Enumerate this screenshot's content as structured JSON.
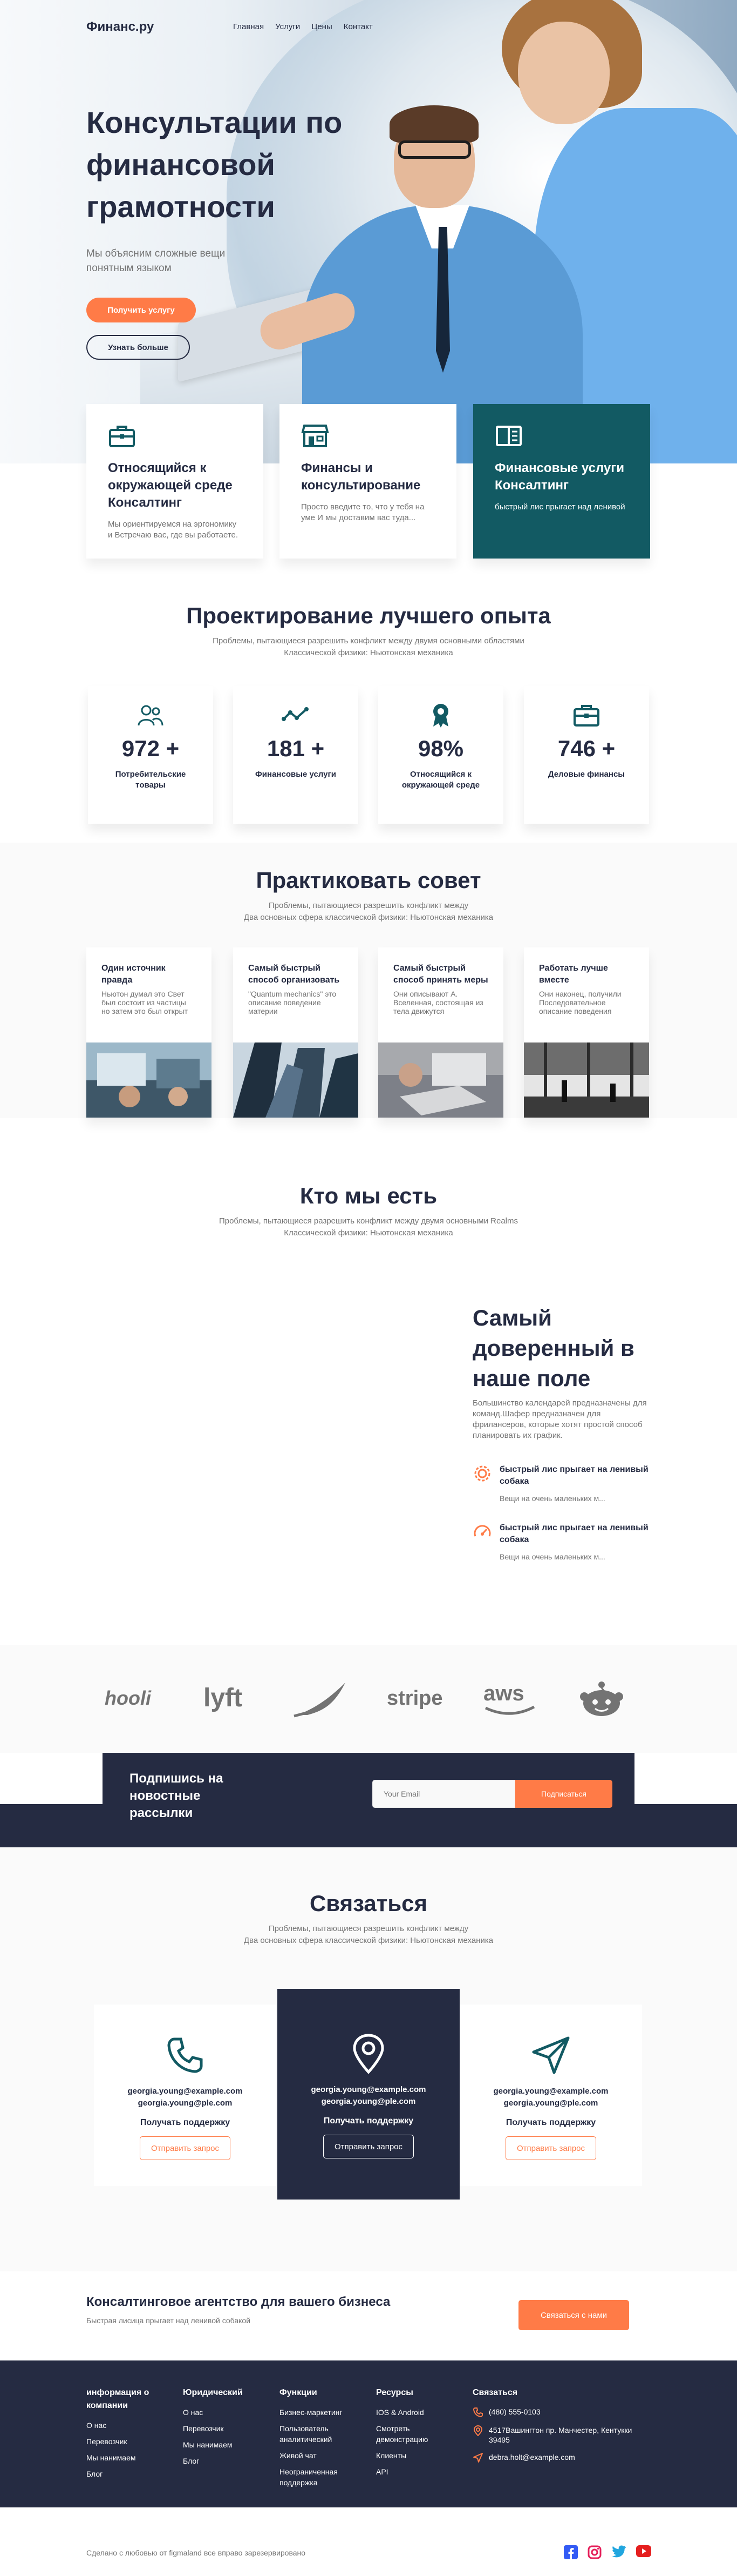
{
  "colors": {
    "primary": "#252b42",
    "accent": "#ff7b47",
    "teal": "#23856d",
    "dark_teal": "#125a63",
    "muted": "#737373"
  },
  "nav": {
    "logo": "Финанс.ру",
    "links": [
      "Главная",
      "Услуги",
      "Цены",
      "Контакт"
    ]
  },
  "hero": {
    "title": "Консультации по финансовой грамотности",
    "subtitle": "Мы объясним сложные вещи понятным языком",
    "primary_button": "Получить услугу",
    "secondary_button": "Узнать больше"
  },
  "features": [
    {
      "icon": "briefcase-icon",
      "title": "Относящийся к окружающей среде Консалтинг",
      "desc": "Мы ориентируемся на эргономику и Встречаю вас, где вы работаете."
    },
    {
      "icon": "storefront-icon",
      "title": "Финансы и консультирование",
      "desc": "Просто введите то, что у тебя на уме И мы доставим вас туда..."
    },
    {
      "icon": "book-icon",
      "title": "Финансовые услуги Консалтинг",
      "desc": "быстрый лис прыгает над ленивой"
    }
  ],
  "experience": {
    "title": "Проектирование лучшего опыта",
    "subtitle_lines": [
      "Проблемы, пытающиеся разрешить конфликт между двумя основными областями",
      "Классической физики: Ньютонская механика"
    ],
    "stats": [
      {
        "icon": "users-icon",
        "number": "972 +",
        "label": "Потребительские товары"
      },
      {
        "icon": "trend-icon",
        "number": "181 +",
        "label": "Финансовые услуги"
      },
      {
        "icon": "award-icon",
        "number": "98%",
        "label": "Относящийся к окружающей среде"
      },
      {
        "icon": "briefcase-icon",
        "number": "746 +",
        "label": "Деловые финансы"
      }
    ]
  },
  "practice": {
    "title": "Практиковать совет",
    "subtitle_lines": [
      "Проблемы, пытающиеся разрешить конфликт между",
      "Два основных сфера классической физики: Ньютонская механика"
    ],
    "cards": [
      {
        "title": "Один источник правда",
        "desc": "Ньютон думал это Свет был состоит из частицы но затем это был открыт"
      },
      {
        "title": "Самый быстрый способ организовать",
        "desc": "\"Quantum mechanics\" это описание поведение материи"
      },
      {
        "title": "Самый быстрый способ принять меры",
        "desc": "Они описывают А. Вселенная, состоящая из тела движутся"
      },
      {
        "title": "Работать лучше вместе",
        "desc": "Они наконец, получили Последовательное описание поведения"
      }
    ]
  },
  "who": {
    "title": "Кто мы есть",
    "subtitle_lines": [
      "Проблемы, пытающиеся разрешить конфликт между двумя основными Realms",
      "Классической физики: Ньютонская механика"
    ],
    "trusted_title": "Самый доверенный в наше поле",
    "trusted_desc": "Большинство календарей предназначены для команд.Шафер предназначен для фрилансеров, которые хотят простой способ планировать их график.",
    "items": [
      {
        "icon": "gear-icon",
        "title": "быстрый лис прыгает на ленивый собака",
        "desc": "Вещи на очень маленьких м..."
      },
      {
        "icon": "speedometer-icon",
        "title": "быстрый лис прыгает на ленивый собака",
        "desc": "Вещи на очень маленьких м..."
      }
    ]
  },
  "logos": [
    "hooli",
    "lyft",
    "leaf",
    "stripe",
    "aws",
    "reddit"
  ],
  "newsletter": {
    "title": "Подпишись на новостные рассылки",
    "placeholder": "Your Email",
    "button": "Подписаться"
  },
  "contact": {
    "title": "Связаться",
    "subtitle_lines": [
      "Проблемы, пытающиеся разрешить конфликт между",
      "Два основных сфера классической физики: Ньютонская механика"
    ],
    "cards": [
      {
        "icon": "phone-icon",
        "email1": "georgia.young@example.com",
        "email2": "georgia.young@ple.com",
        "support": "Получать поддержку",
        "button": "Отправить запрос"
      },
      {
        "icon": "location-icon",
        "email1": "georgia.young@example.com",
        "email2": "georgia.young@ple.com",
        "support": "Получать поддержку",
        "button": "Отправить запрос"
      },
      {
        "icon": "send-icon",
        "email1": "georgia.young@example.com",
        "email2": "georgia.young@ple.com",
        "support": "Получать поддержку",
        "button": "Отправить запрос"
      }
    ]
  },
  "cta": {
    "title": "Консалтинговое агентство для вашего бизнеса",
    "subtitle": "Быстрая лисица прыгает над ленивой собакой",
    "button": "Связаться с нами"
  },
  "footer": {
    "columns": [
      {
        "heading": "информация о компании",
        "items": [
          "О нас",
          "Перевозчик",
          "Мы нанимаем",
          "Блог"
        ]
      },
      {
        "heading": "Юридический",
        "items": [
          "О нас",
          "Перевозчик",
          "Мы нанимаем",
          "Блог"
        ]
      },
      {
        "heading": "Функции",
        "items": [
          "Бизнес-маркетинг",
          "Пользователь аналитический",
          "Живой чат",
          "Неограниченная поддержка"
        ]
      },
      {
        "heading": "Ресурсы",
        "items": [
          "IOS & Android",
          "Смотреть демонстрацию",
          "Клиенты",
          "API"
        ]
      }
    ],
    "contact_heading": "Связаться",
    "contact_items": [
      {
        "icon": "phone-icon",
        "text": "(480) 555-0103"
      },
      {
        "icon": "location-icon",
        "text": "4517Вашингтон пр. Манчестер, Кентукки 39495"
      },
      {
        "icon": "send-icon",
        "text": "debra.holt@example.com"
      }
    ],
    "copyright": "Сделано с любовью от figmaland все вправо зарезервировано",
    "socials": [
      "facebook-icon",
      "instagram-icon",
      "twitter-icon",
      "youtube-icon"
    ]
  }
}
